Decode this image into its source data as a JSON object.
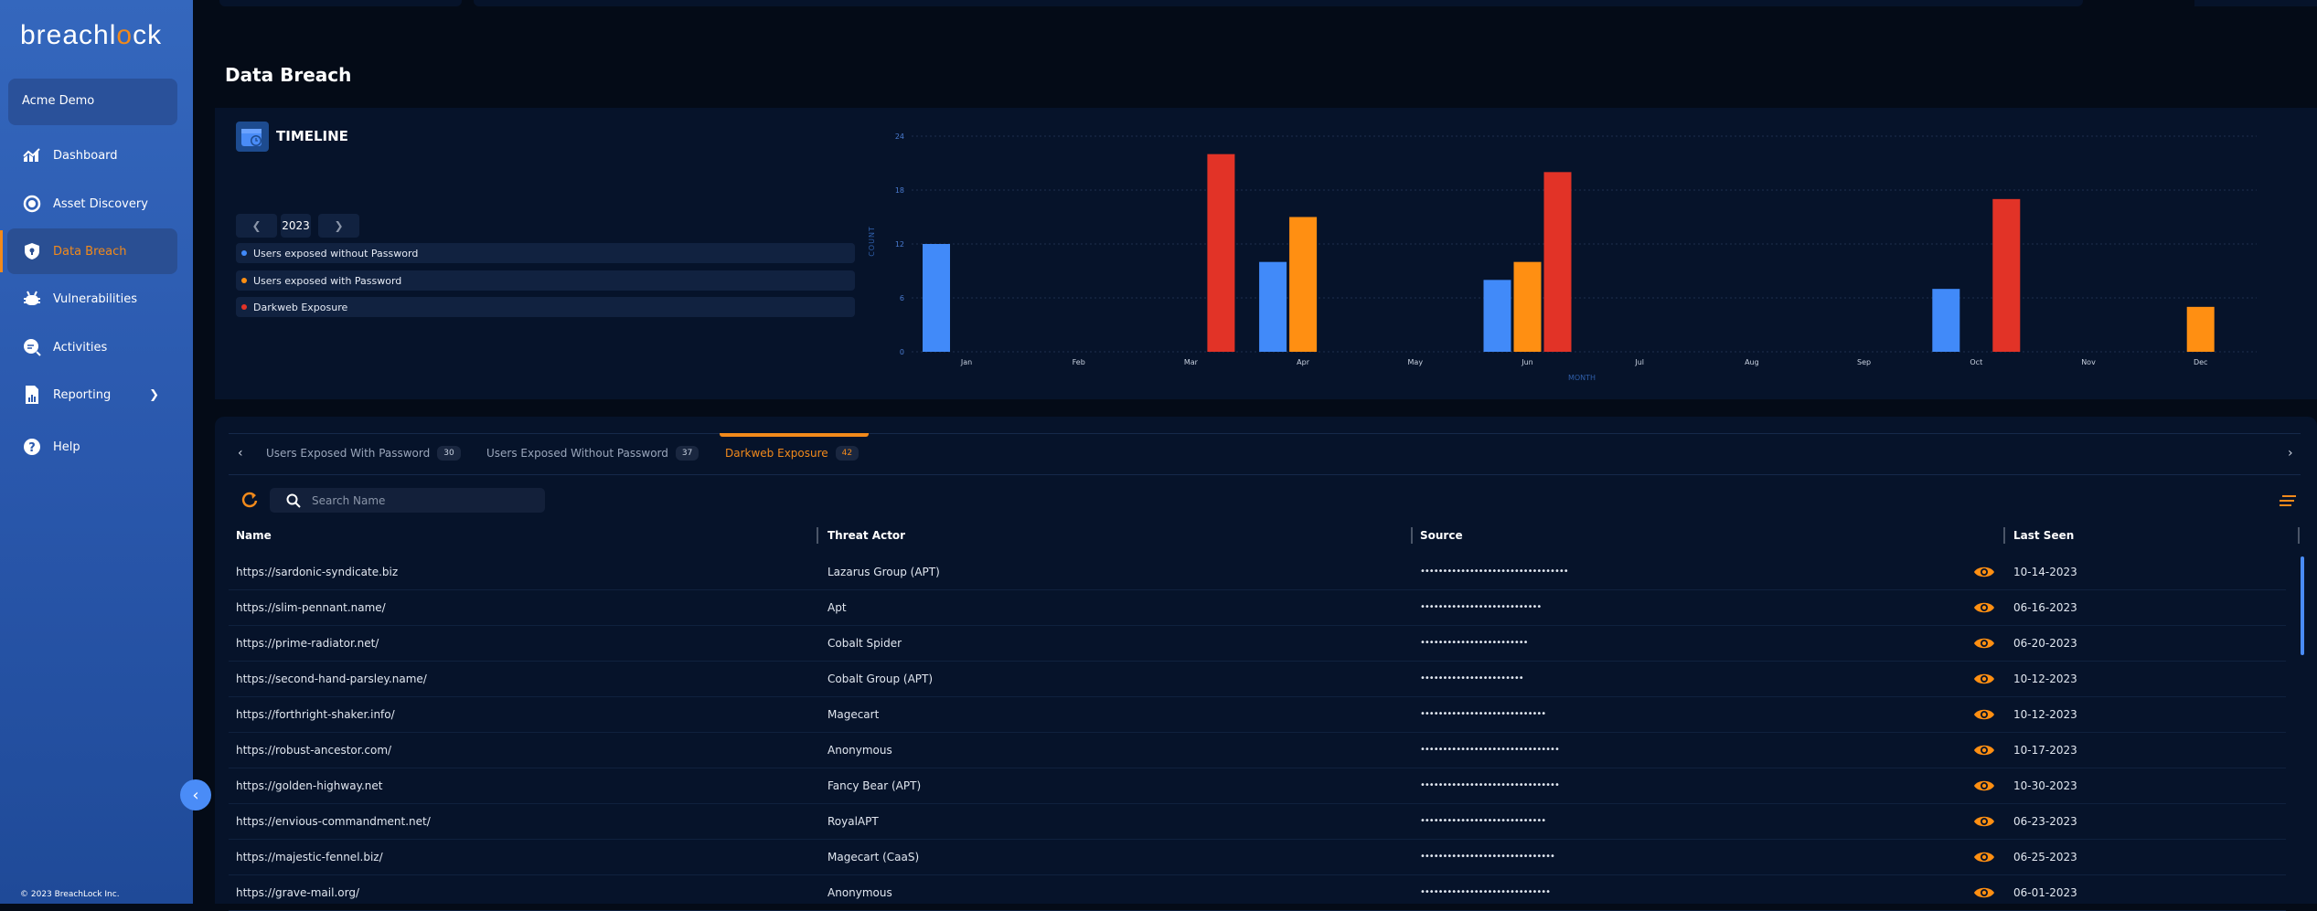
{
  "sidebar": {
    "logo": "breachlock",
    "org": "Acme Demo",
    "items": [
      {
        "label": "Dashboard",
        "icon": "chart-up-icon"
      },
      {
        "label": "Asset Discovery",
        "icon": "target-icon"
      },
      {
        "label": "Data Breach",
        "icon": "shield-icon",
        "active": true
      },
      {
        "label": "Vulnerabilities",
        "icon": "bug-icon"
      },
      {
        "label": "Activities",
        "icon": "activity-search-icon"
      },
      {
        "label": "Reporting",
        "icon": "report-icon"
      },
      {
        "label": "Help",
        "icon": "help-icon"
      }
    ],
    "footer": "© 2023 BreachLock Inc."
  },
  "page": {
    "title": "Data Breach"
  },
  "timeline": {
    "title": "TIMELINE",
    "year": "2023",
    "legend": [
      {
        "label": "Users exposed without Password",
        "color": "#418af9"
      },
      {
        "label": "Users exposed with Password",
        "color": "#ff8f12"
      },
      {
        "label": "Darkweb Exposure",
        "color": "#e23327"
      }
    ]
  },
  "chart_data": {
    "type": "bar",
    "xlabel": "MONTH",
    "ylabel": "COUNT",
    "ylim": [
      0,
      24
    ],
    "yticks": [
      0,
      6,
      12,
      18,
      24
    ],
    "grid": true,
    "categories": [
      "Jan",
      "Feb",
      "Mar",
      "Apr",
      "May",
      "Jun",
      "Jul",
      "Aug",
      "Sep",
      "Oct",
      "Nov",
      "Dec"
    ],
    "series": [
      {
        "name": "Users exposed without Password",
        "color": "#418af9",
        "values": [
          12,
          0,
          0,
          10,
          0,
          8,
          0,
          0,
          0,
          7,
          0,
          0
        ]
      },
      {
        "name": "Users exposed with Password",
        "color": "#ff8f12",
        "values": [
          0,
          0,
          0,
          15,
          0,
          10,
          0,
          0,
          0,
          0,
          0,
          5
        ]
      },
      {
        "name": "Darkweb Exposure",
        "color": "#e23327",
        "values": [
          0,
          0,
          22,
          0,
          0,
          20,
          0,
          0,
          0,
          17,
          0,
          0
        ]
      }
    ]
  },
  "tabs": [
    {
      "label": "Users Exposed With Password",
      "count": "30"
    },
    {
      "label": "Users Exposed Without Password",
      "count": "37"
    },
    {
      "label": "Darkweb Exposure",
      "count": "42",
      "active": true
    }
  ],
  "search": {
    "placeholder": "Search Name",
    "value": ""
  },
  "table": {
    "columns": [
      "Name",
      "Threat Actor",
      "Source",
      "Last Seen"
    ],
    "rows": [
      {
        "name": "https://sardonic-syndicate.biz",
        "actor": "Lazarus Group (APT)",
        "source": "•••••••••••••••••••••••••••••••••",
        "seen": "10-14-2023"
      },
      {
        "name": "https://slim-pennant.name/",
        "actor": "Apt",
        "source": "•••••••••••••••••••••••••••",
        "seen": "06-16-2023"
      },
      {
        "name": "https://prime-radiator.net/",
        "actor": "Cobalt Spider",
        "source": "••••••••••••••••••••••••",
        "seen": "06-20-2023"
      },
      {
        "name": "https://second-hand-parsley.name/",
        "actor": "Cobalt Group (APT)",
        "source": "•••••••••••••••••••••••",
        "seen": "10-12-2023"
      },
      {
        "name": "https://forthright-shaker.info/",
        "actor": "Magecart",
        "source": "••••••••••••••••••••••••••••",
        "seen": "10-12-2023"
      },
      {
        "name": "https://robust-ancestor.com/",
        "actor": "Anonymous",
        "source": "•••••••••••••••••••••••••••••••",
        "seen": "10-17-2023"
      },
      {
        "name": "https://golden-highway.net",
        "actor": "Fancy Bear (APT)",
        "source": "•••••••••••••••••••••••••••••••",
        "seen": "10-30-2023"
      },
      {
        "name": "https://envious-commandment.net/",
        "actor": "RoyalAPT",
        "source": "••••••••••••••••••••••••••••",
        "seen": "06-23-2023"
      },
      {
        "name": "https://majestic-fennel.biz/",
        "actor": "Magecart (CaaS)",
        "source": "••••••••••••••••••••••••••••••",
        "seen": "06-25-2023"
      },
      {
        "name": "https://grave-mail.org/",
        "actor": "Anonymous",
        "source": "•••••••••••••••••••••••••••••",
        "seen": "06-01-2023"
      }
    ]
  },
  "colors": {
    "accent": "#f28a1b",
    "sidebar": "#2a58ad",
    "panel": "#06132a"
  }
}
